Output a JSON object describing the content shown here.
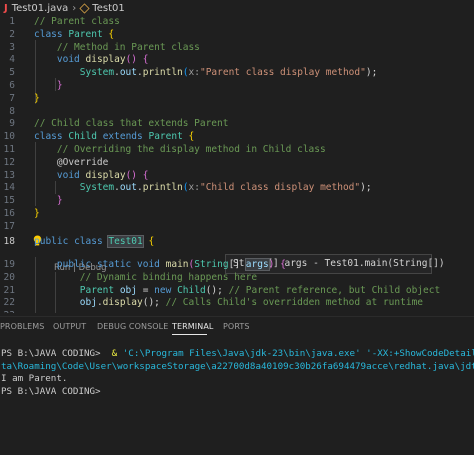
{
  "breadcrumb": {
    "file": "Test01.java",
    "symbol": "Test01"
  },
  "editor": {
    "lines": [
      {
        "n": "1"
      },
      {
        "n": "2"
      },
      {
        "n": "3"
      },
      {
        "n": "4"
      },
      {
        "n": "5"
      },
      {
        "n": "6"
      },
      {
        "n": "7"
      },
      {
        "n": "8"
      },
      {
        "n": "9"
      },
      {
        "n": "10"
      },
      {
        "n": "11"
      },
      {
        "n": "12"
      },
      {
        "n": "13"
      },
      {
        "n": "14"
      },
      {
        "n": "15"
      },
      {
        "n": "16"
      },
      {
        "n": "17"
      },
      {
        "n": "18"
      },
      {
        "n": "19"
      },
      {
        "n": "20"
      },
      {
        "n": "21"
      },
      {
        "n": "22"
      },
      {
        "n": "23"
      }
    ],
    "active_line": "18",
    "code": {
      "l1": "// Parent class",
      "l2_kw": "class",
      "l2_cls": "Parent",
      "l2_br": "{",
      "l3": "// Method in Parent class",
      "l4_kw": "void",
      "l4_fn": "display",
      "l4_p": "()",
      "l4_br": "{",
      "l5_sys": "System",
      "l5_out": "out",
      "l5_fn": "println",
      "l5_hint": "x:",
      "l5_str": "\"Parent class display method\"",
      "l5_end": ");",
      "l6_br": "}",
      "l7_br": "}",
      "l9": "// Child class that extends Parent",
      "l10_kw": "class",
      "l10_cls": "Child",
      "l10_ext": "extends",
      "l10_par": "Parent",
      "l10_br": "{",
      "l11": "// Overriding the display method in Child class",
      "l12": "@Override",
      "l13_kw": "void",
      "l13_fn": "display",
      "l13_p": "()",
      "l13_br": "{",
      "l14_sys": "System",
      "l14_out": "out",
      "l14_fn": "println",
      "l14_hint": "x:",
      "l14_str": "\"Child class display method\"",
      "l14_end": ");",
      "l15_br": "}",
      "l16_br": "}",
      "l18_kw1": "public",
      "l18_kw2": "class",
      "l18_cls": "Test01",
      "l18_br": "{",
      "codelens": "Run | Debug",
      "l19_kw1": "public",
      "l19_kw2": "static",
      "l19_kw3": "void",
      "l19_fn": "main",
      "l19_ty": "String",
      "l19_arr": "[]",
      "l19_arg": "args",
      "l19_br": "{",
      "l20": "// Dynamic binding happens here",
      "l21_ty": "Parent",
      "l21_var": "obj",
      "l21_new": "new",
      "l21_cls": "Child",
      "l21_end": "();",
      "l21_cm": "// Parent reference, but Child object",
      "l22_var": "obj",
      "l22_fn": "display",
      "l22_end": "();",
      "l22_cm": "// Calls Child's overridden method at runtime"
    },
    "tooltip": "String[] args - Test01.main(String[])"
  },
  "panel": {
    "tabs": [
      "PROBLEMS",
      "OUTPUT",
      "DEBUG CONSOLE",
      "TERMINAL",
      "PORTS"
    ],
    "active_tab": "TERMINAL"
  },
  "terminal": {
    "l1_prompt": "PS B:\\JAVA CODING>",
    "l1_amp": "&",
    "l1_exe": "'C:\\Program Files\\Java\\jdk-23\\bin\\java.exe'",
    "l1_args": "'-XX:+ShowCodeDetailsInExcept",
    "l2": "ta\\Roaming\\Code\\User\\workspaceStorage\\a22700d8a40109c30b26fa694479acce\\redhat.java\\jdt_ws\\JAVA C",
    "l3": "I am Parent.",
    "l4_prompt": "PS B:\\JAVA CODING>"
  },
  "colors": {
    "background": "#1f1f1f",
    "keyword": "#569cd6",
    "type": "#4ec9b0",
    "function": "#dcdcaa",
    "comment": "#6a9955",
    "string": "#ce9178",
    "java_icon": "#f14c4c"
  },
  "icons": [
    "java-icon",
    "chevron-right-icon",
    "class-symbol-icon",
    "lightbulb-icon"
  ]
}
